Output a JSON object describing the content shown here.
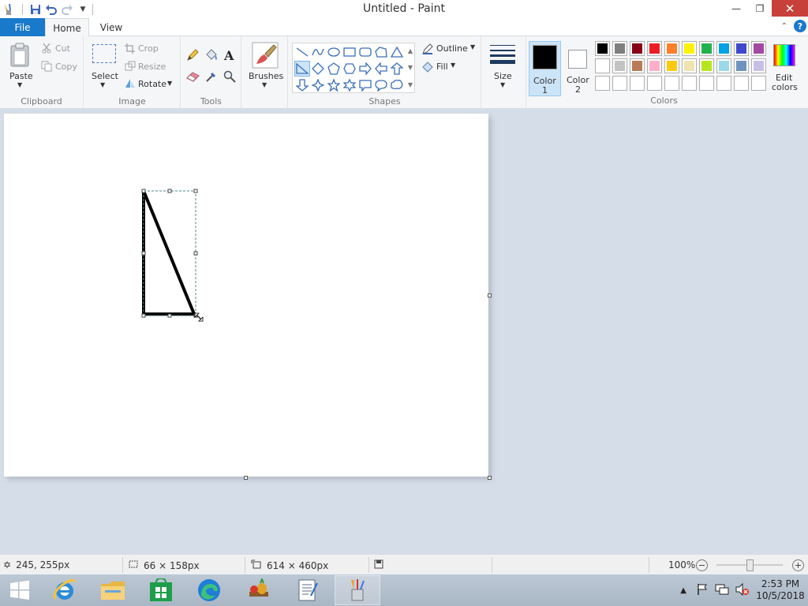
{
  "window": {
    "title": "Untitled - Paint"
  },
  "tabs": {
    "file": "File",
    "home": "Home",
    "view": "View"
  },
  "clipboard": {
    "paste": "Paste",
    "cut": "Cut",
    "copy": "Copy",
    "label": "Clipboard"
  },
  "image": {
    "select": "Select",
    "crop": "Crop",
    "resize": "Resize",
    "rotate": "Rotate",
    "label": "Image"
  },
  "tools": {
    "label": "Tools"
  },
  "brushes": {
    "label": "Brushes"
  },
  "shapes": {
    "outline": "Outline",
    "fill": "Fill",
    "label": "Shapes"
  },
  "size": {
    "label": "Size"
  },
  "colors": {
    "color1_line1": "Color",
    "color1_line2": "1",
    "color2_line1": "Color",
    "color2_line2": "2",
    "edit_line1": "Edit",
    "edit_line2": "colors",
    "label": "Colors",
    "color1_value": "#000000",
    "color2_value": "#ffffff",
    "row1": [
      "#000000",
      "#7f7f7f",
      "#880015",
      "#ed1c24",
      "#ff7f27",
      "#fff200",
      "#22b14c",
      "#00a2e8",
      "#3f48cc",
      "#a349a4"
    ],
    "row2": [
      "#ffffff",
      "#c3c3c3",
      "#b97a57",
      "#ffaec9",
      "#ffc90e",
      "#efe4b0",
      "#b5e61d",
      "#99d9ea",
      "#7092be",
      "#c8bfe7"
    ]
  },
  "status": {
    "cursor_pos": "245, 255px",
    "selection_size": "66 × 158px",
    "canvas_size": "614 × 460px",
    "zoom": "100%",
    "zoom_level": 0.5
  },
  "clock": {
    "time": "2:53 PM",
    "date": "10/5/2018"
  }
}
